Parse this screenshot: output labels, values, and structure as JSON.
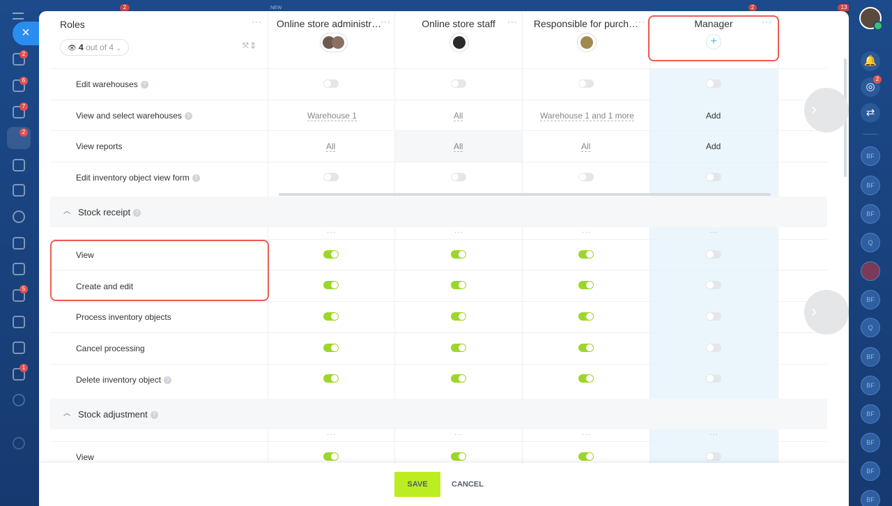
{
  "roles_header": {
    "title": "Roles",
    "filter_count": "4",
    "filter_suffix": "out of 4",
    "header_dots": "···"
  },
  "columns": [
    {
      "name": "Online store administr…"
    },
    {
      "name": "Online store staff"
    },
    {
      "name": "Responsible for purch…"
    },
    {
      "name": "Manager",
      "add_icon": "+"
    }
  ],
  "rows_top": [
    {
      "label": "Edit warehouses",
      "help": "?",
      "cells": [
        "off",
        "off",
        "off",
        "off"
      ]
    },
    {
      "label": "View and select warehouses",
      "help": "?",
      "cells": [
        "Warehouse 1",
        "All",
        "Warehouse 1 and 1 more",
        "Add"
      ]
    },
    {
      "label": "View reports",
      "help": "",
      "cells": [
        "All",
        "All",
        "All",
        "Add"
      ]
    },
    {
      "label": "Edit inventory object view form",
      "help": "?",
      "cells": [
        "off",
        "off",
        "off",
        "off"
      ]
    }
  ],
  "section_stock_receipt": {
    "title": "Stock receipt",
    "help": "?",
    "collapse_icon": "chevron-up-icon",
    "dots": "···",
    "rows": [
      {
        "label": "View",
        "help": "",
        "cells": [
          "on",
          "on",
          "on",
          "off"
        ]
      },
      {
        "label": "Create and edit",
        "help": "",
        "cells": [
          "on",
          "on",
          "on",
          "off"
        ]
      },
      {
        "label": "Process inventory objects",
        "help": "",
        "cells": [
          "on",
          "on",
          "on",
          "off"
        ]
      },
      {
        "label": "Cancel processing",
        "help": "",
        "cells": [
          "on",
          "on",
          "on",
          "off"
        ]
      },
      {
        "label": "Delete inventory object",
        "help": "?",
        "cells": [
          "on",
          "on",
          "on",
          "off"
        ]
      }
    ]
  },
  "section_stock_adjustment": {
    "title": "Stock adjustment",
    "help": "?",
    "dots": "···",
    "rows": [
      {
        "label": "View",
        "help": "",
        "cells": [
          "on",
          "on",
          "on",
          "off"
        ]
      }
    ]
  },
  "footer": {
    "save_label": "SAVE",
    "cancel_label": "CANCEL"
  },
  "left_sidebar": {
    "close_icon": "×",
    "badges": [
      "2",
      "2",
      "6",
      "7",
      "2",
      "5",
      "1"
    ]
  },
  "right_sidebar": {
    "notification_badge": "2",
    "avatars": [
      "BF",
      "BF",
      "BF",
      "Q",
      "BF",
      "Q",
      "BF",
      "BF",
      "BF",
      "BF",
      "BF"
    ]
  },
  "top_badges": {
    "tab": "2",
    "new": "NEW",
    "right1": "2",
    "right2": "13"
  },
  "colors": {
    "accent_green": "#bbed21",
    "toggle_on": "#9dd62a",
    "highlight_red": "#ee5a52",
    "manager_bg": "#eaf6fc",
    "sidebar_blue": "#1c4a8a"
  }
}
